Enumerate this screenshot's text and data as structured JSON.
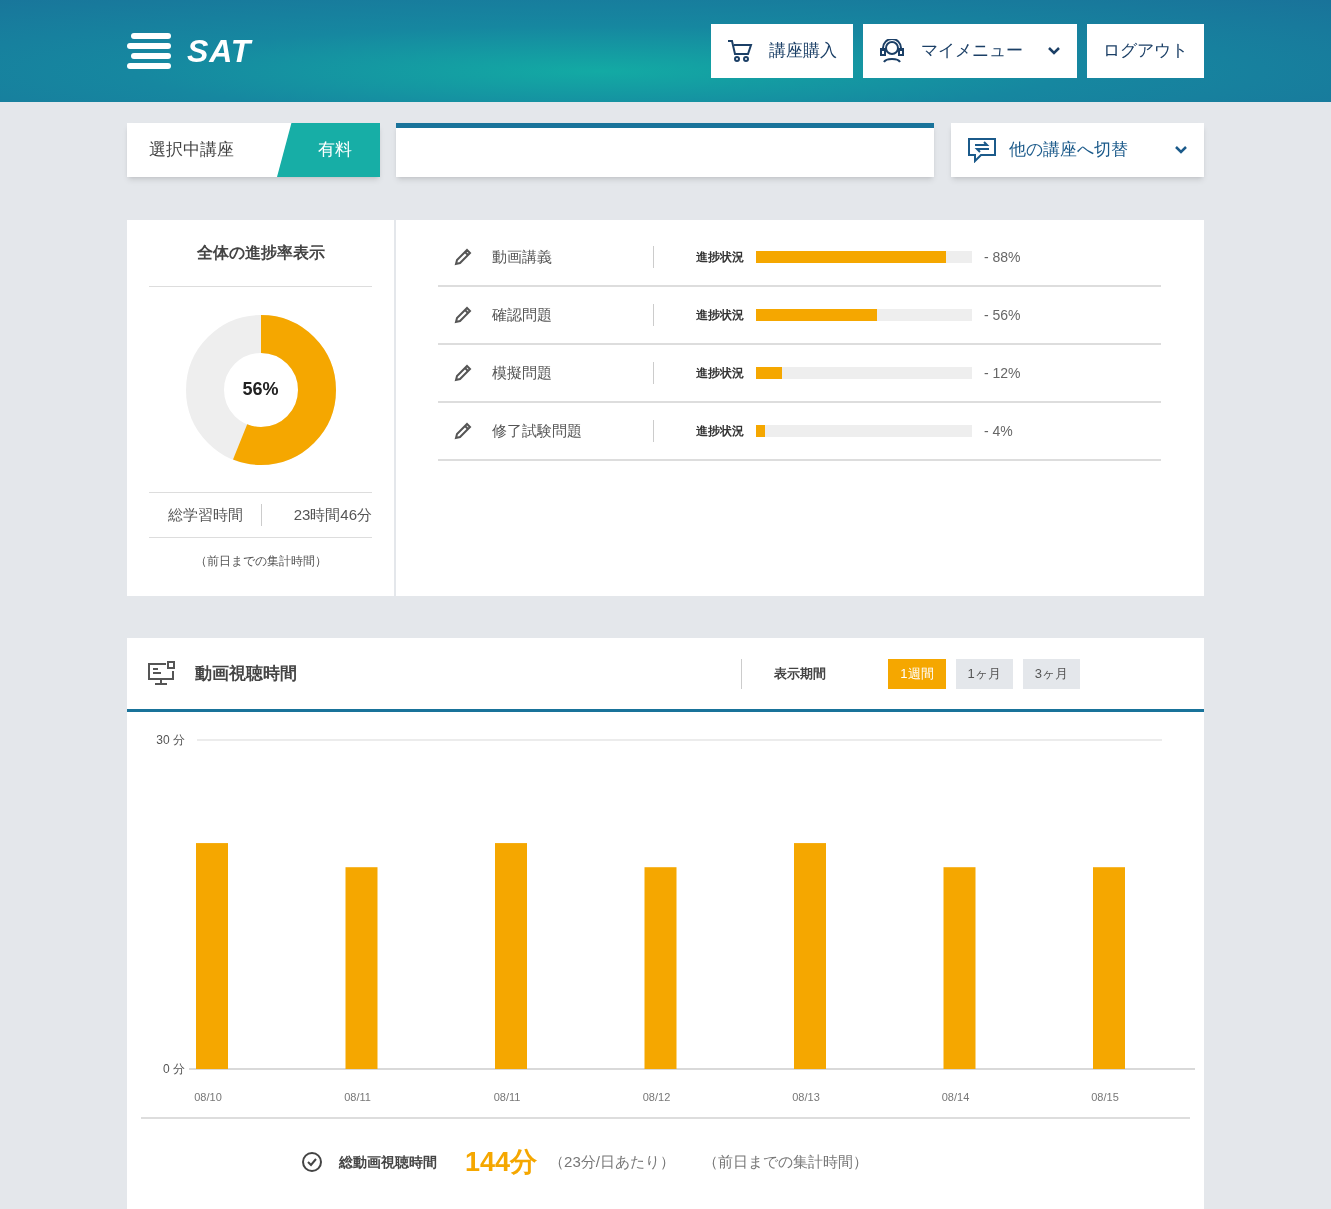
{
  "header": {
    "logo": "SAT",
    "buttons": [
      {
        "kind": "cart",
        "label": "講座購入"
      },
      {
        "kind": "menu",
        "label": "マイメニュー"
      },
      {
        "kind": "plain",
        "label": "ログアウト"
      }
    ]
  },
  "course_bar": {
    "label": "選択中講座",
    "badge": "有料",
    "switch_label": "他の講座へ切替"
  },
  "overall": {
    "title": "全体の進捗率表示",
    "level": 0.56,
    "percent": "56%",
    "study_time_label": "総学習時間",
    "study_time": "23時間46分",
    "note": "（前日までの集計時間）"
  },
  "progress_rows": [
    {
      "name": "動画講義",
      "status_label": "進捗状況",
      "level": 0.88,
      "reading": "- 88%"
    },
    {
      "name": "確認問題",
      "status_label": "進捗状況",
      "level": 0.56,
      "reading": "- 56%"
    },
    {
      "name": "模擬問題",
      "status_label": "進捗状況",
      "level": 0.12,
      "reading": "- 12%"
    },
    {
      "name": "修了試験問題",
      "status_label": "進捗状況",
      "level": 0.04,
      "reading": "- 4%"
    }
  ],
  "viewing": {
    "title": "動画視聴時間",
    "period_label": "表示期間",
    "periods": [
      {
        "label": "1週間",
        "selected": true
      },
      {
        "label": "1ヶ月",
        "selected": false
      },
      {
        "label": "3ヶ月",
        "selected": false
      }
    ],
    "chart_data": {
      "type": "bar",
      "categories": [
        "08/10",
        "08/11",
        "08/11",
        "08/12",
        "08/13",
        "08/14",
        "08/15"
      ],
      "yticks": [
        {
          "value": 0,
          "label": "0 分"
        },
        {
          "value": 30,
          "label": "30 分"
        }
      ],
      "ylim": [
        0,
        30
      ],
      "values": [
        20.6,
        18.4,
        20.6,
        18.4,
        20.6,
        18.4,
        18.4
      ]
    },
    "total_label": "総動画視聴時間",
    "total": "144分",
    "per_day": "（23分/日あたり）",
    "note": "（前日までの集計時間）"
  }
}
